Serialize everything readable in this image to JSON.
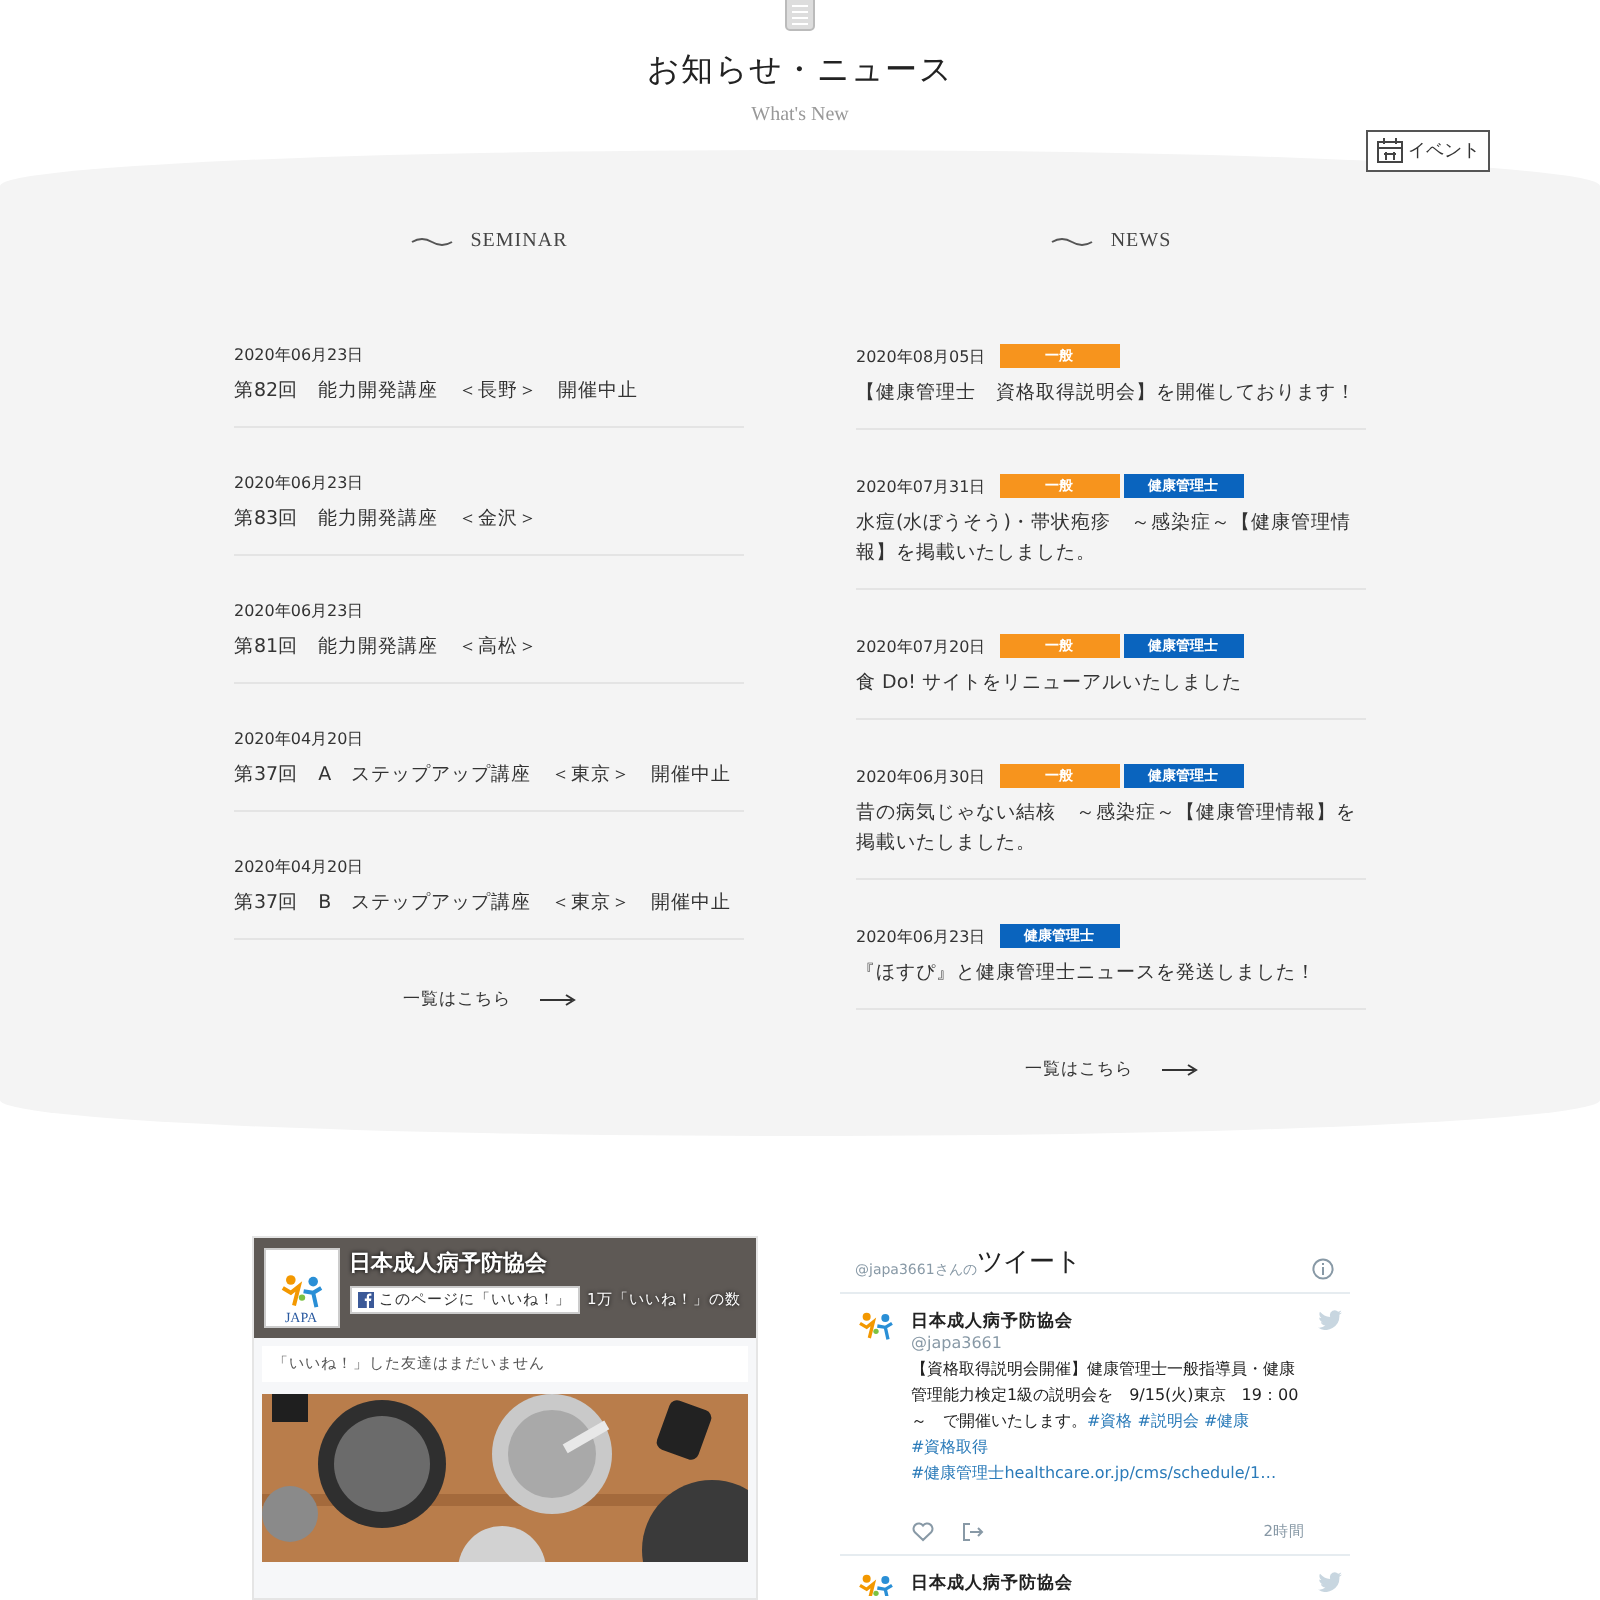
{
  "header": {
    "title": "お知らせ・ニュース",
    "subtitle": "What's New",
    "event_link": "イベント"
  },
  "seminar": {
    "heading": "SEMINAR",
    "more": "一覧はこちら",
    "items": [
      {
        "date": "2020年06月23日",
        "title": "第82回　能力開発講座　＜長野＞　開催中止"
      },
      {
        "date": "2020年06月23日",
        "title": "第83回　能力開発講座　＜金沢＞"
      },
      {
        "date": "2020年06月23日",
        "title": "第81回　能力開発講座　＜高松＞"
      },
      {
        "date": "2020年04月20日",
        "title": "第37回　A　ステップアップ講座　＜東京＞　開催中止"
      },
      {
        "date": "2020年04月20日",
        "title": "第37回　B　ステップアップ講座　＜東京＞　開催中止"
      }
    ]
  },
  "news": {
    "heading": "NEWS",
    "more": "一覧はこちら",
    "items": [
      {
        "date": "2020年08月05日",
        "tags": [
          {
            "label": "一般",
            "color": "#f7941d"
          }
        ],
        "title": "【健康管理士　資格取得説明会】を開催しております！"
      },
      {
        "date": "2020年07月31日",
        "tags": [
          {
            "label": "一般",
            "color": "#f7941d"
          },
          {
            "label": "健康管理士",
            "color": "#0a64be"
          }
        ],
        "title": "水痘(水ぼうそう)・帯状疱疹　～感染症～【健康管理情報】を掲載いたしました。"
      },
      {
        "date": "2020年07月20日",
        "tags": [
          {
            "label": "一般",
            "color": "#f7941d"
          },
          {
            "label": "健康管理士",
            "color": "#0a64be"
          }
        ],
        "title": "食 Do! サイトをリニューアルいたしました"
      },
      {
        "date": "2020年06月30日",
        "tags": [
          {
            "label": "一般",
            "color": "#f7941d"
          },
          {
            "label": "健康管理士",
            "color": "#0a64be"
          }
        ],
        "title": "昔の病気じゃない結核　～感染症～【健康管理情報】を掲載いたしました。"
      },
      {
        "date": "2020年06月23日",
        "tags": [
          {
            "label": "健康管理士",
            "color": "#0a64be"
          }
        ],
        "title": "『ほすぴ』と健康管理士ニュースを発送しました！"
      }
    ]
  },
  "facebook": {
    "logo_text": "JAPA",
    "page_name": "日本成人病予防協会",
    "like_button": "このページに「いいね！」",
    "like_count": "1万「いいね！」の数",
    "friends_note": "「いいね！」した友達はまだいません"
  },
  "twitter": {
    "handle_prefix": "@japa3661さんの",
    "title": "ツイート",
    "tweets": [
      {
        "name": "日本成人病予防協会",
        "handle": "@japa3661",
        "time": "2時間",
        "body": [
          {
            "text": "【資格取得説明会開催】健康管理士一般指導員・健康管理能力検定1級の説明会を　9/15(火)東京　19：00～　で開催いたします。",
            "link": false
          },
          {
            "text": "#資格",
            "link": true
          },
          {
            "text": "#説明会",
            "link": true
          },
          {
            "text": "#健康",
            "link": true
          },
          {
            "text": "#資格取得",
            "link": true
          },
          {
            "text": "#健康管理士healthcare.or.jp/cms/schedule/1…",
            "link": true
          }
        ]
      },
      {
        "name": "日本成人病予防協会"
      }
    ]
  }
}
